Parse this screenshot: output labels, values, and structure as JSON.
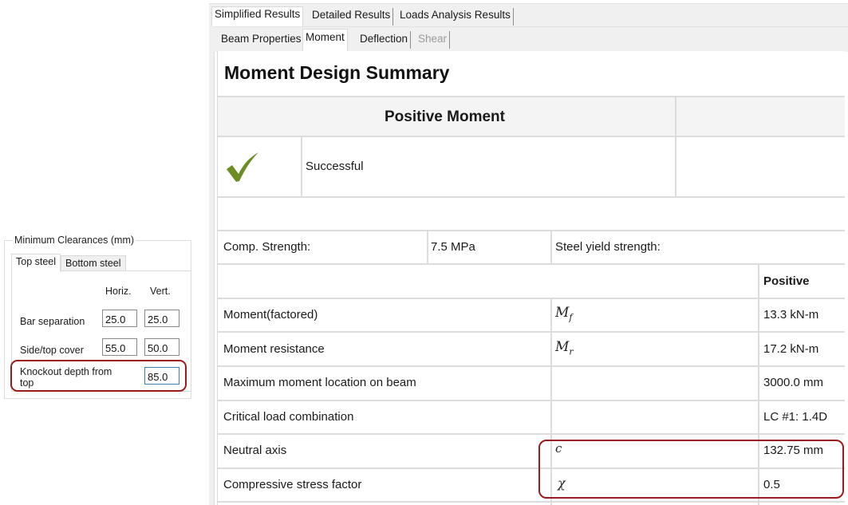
{
  "clearances": {
    "group_title": "Minimum Clearances (mm)",
    "tabs": [
      {
        "label": "Top steel",
        "active": true
      },
      {
        "label": "Bottom steel",
        "active": false
      }
    ],
    "columns": [
      "Horiz.",
      "Vert."
    ],
    "rows": [
      {
        "label": "Bar separation",
        "horiz": "25.0",
        "vert": "25.0"
      },
      {
        "label": "Side/top cover",
        "horiz": "55.0",
        "vert": "50.0"
      },
      {
        "label": "Knockout depth from top",
        "value": "85.0"
      }
    ],
    "highlight_color": "#9b1b1b"
  },
  "results": {
    "main_tabs": [
      {
        "label": "Simplified Results",
        "active": true
      },
      {
        "label": "Detailed Results",
        "active": false
      },
      {
        "label": "Loads Analysis Results",
        "active": false
      }
    ],
    "sub_tabs": [
      {
        "label": "Beam Properties",
        "active": false,
        "disabled": false
      },
      {
        "label": "Moment",
        "active": true,
        "disabled": false
      },
      {
        "label": "Deflection",
        "active": false,
        "disabled": false
      },
      {
        "label": "Shear",
        "active": false,
        "disabled": true
      }
    ],
    "title": "Moment Design Summary",
    "summary": {
      "header": "Positive Moment",
      "status_icon": "checkmark-icon",
      "status_color": "#6b8e23",
      "status_text": "Successful"
    },
    "materials": {
      "comp_strength_label": "Comp. Strength:",
      "comp_strength_value": "7.5 MPa",
      "steel_yield_label": "Steel yield strength:"
    },
    "table": {
      "column_header": "Positive",
      "rows": [
        {
          "label": "Moment(factored)",
          "symbol": "M",
          "subscript": "f",
          "value": "13.3 kN-m"
        },
        {
          "label": "Moment resistance",
          "symbol": "M",
          "subscript": "r",
          "value": "17.2 kN-m"
        },
        {
          "label": "Maximum moment location on beam",
          "symbol": "",
          "subscript": "",
          "value": "3000.0 mm"
        },
        {
          "label": "Critical load combination",
          "symbol": "",
          "subscript": "",
          "value": "LC #1: 1.4D"
        },
        {
          "label": "Neutral axis",
          "symbol": "c",
          "subscript": "",
          "value": "132.75 mm"
        },
        {
          "label": "Compressive stress factor",
          "symbol": "χ",
          "subscript": "",
          "value": "0.5"
        }
      ]
    }
  }
}
